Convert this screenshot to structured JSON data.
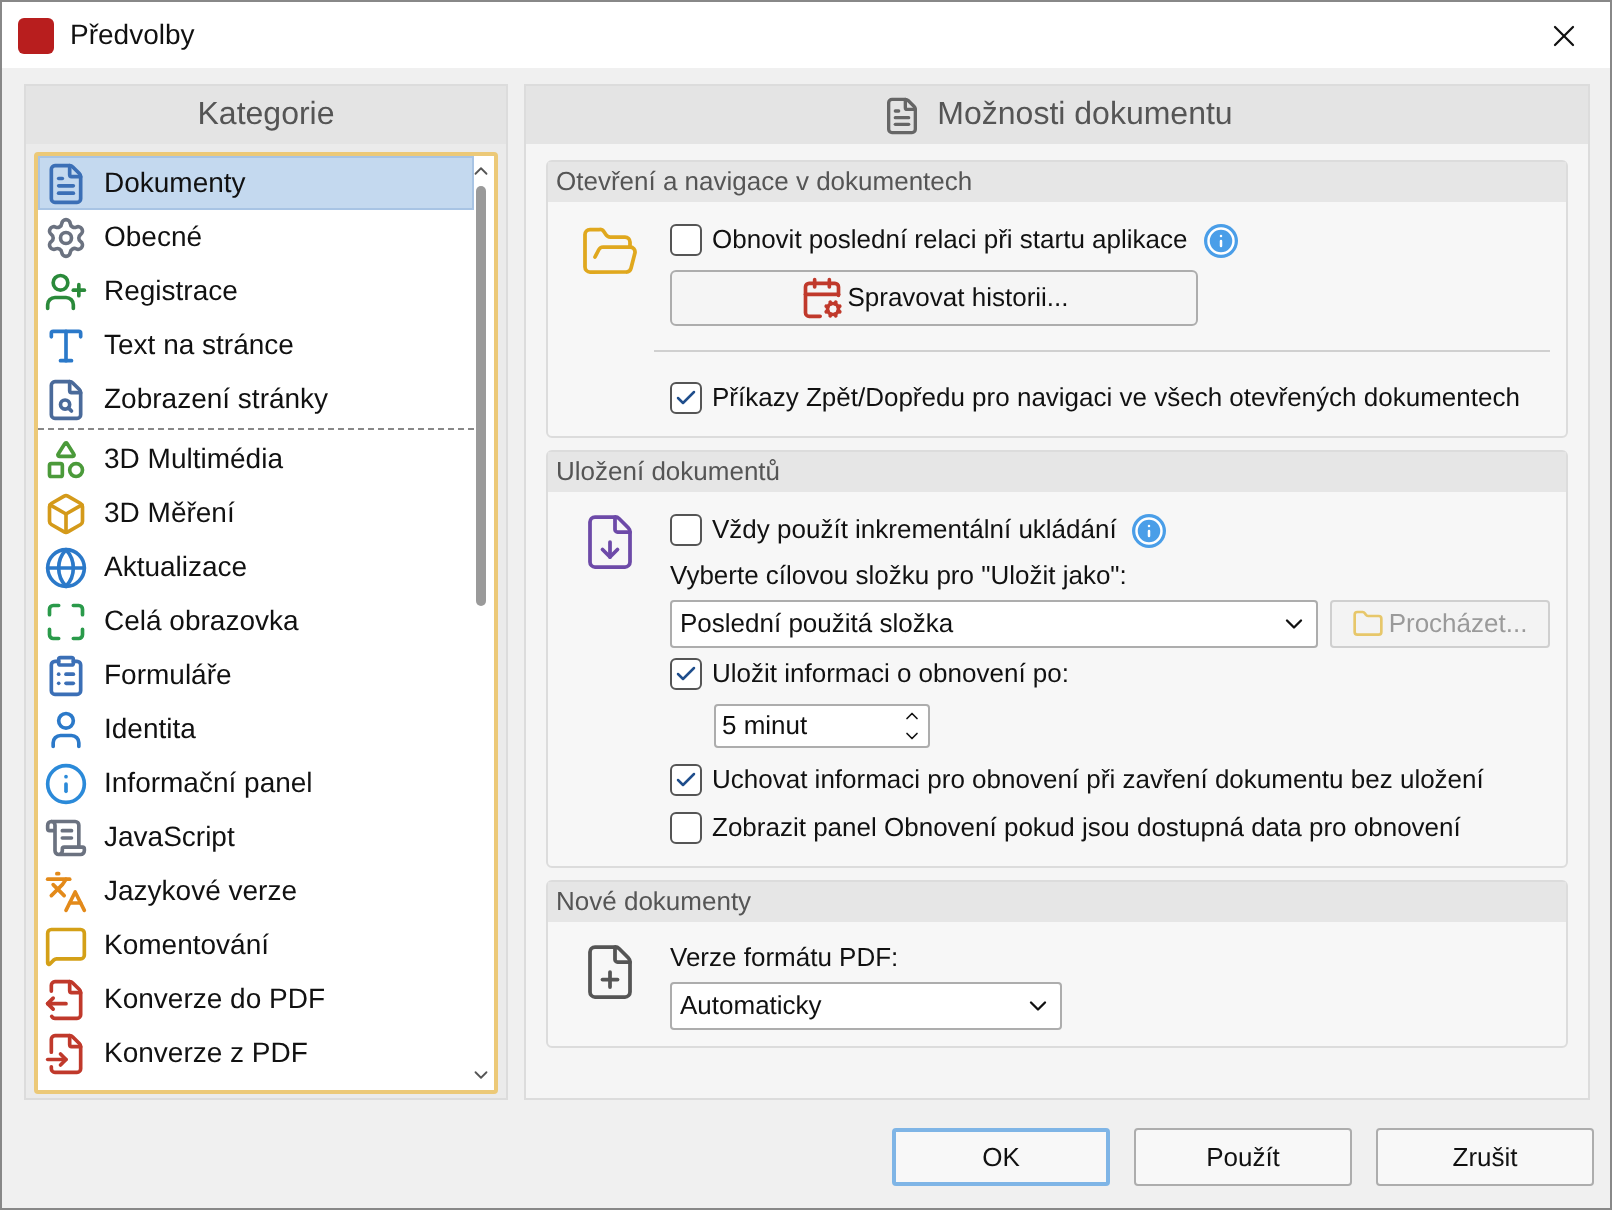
{
  "window": {
    "title": "Předvolby"
  },
  "sidebar": {
    "title": "Kategorie",
    "groups": [
      {
        "items": [
          {
            "label": "Dokumenty",
            "selected": true
          },
          {
            "label": "Obecné",
            "selected": false
          },
          {
            "label": "Registrace",
            "selected": false
          },
          {
            "label": "Text na stránce",
            "selected": false
          },
          {
            "label": "Zobrazení stránky",
            "selected": false
          }
        ]
      },
      {
        "items": [
          {
            "label": "3D Multimédia",
            "selected": false
          },
          {
            "label": "3D Měření",
            "selected": false
          },
          {
            "label": "Aktualizace",
            "selected": false
          },
          {
            "label": "Celá obrazovka",
            "selected": false
          },
          {
            "label": "Formuláře",
            "selected": false
          },
          {
            "label": "Identita",
            "selected": false
          },
          {
            "label": "Informační panel",
            "selected": false
          },
          {
            "label": "JavaScript",
            "selected": false
          },
          {
            "label": "Jazykové verze",
            "selected": false
          },
          {
            "label": "Komentování",
            "selected": false
          },
          {
            "label": "Konverze do PDF",
            "selected": false
          },
          {
            "label": "Konverze z PDF",
            "selected": false
          }
        ]
      }
    ]
  },
  "main": {
    "title": "Možnosti dokumentu",
    "sections": [
      {
        "title": "Otevření a navigace v dokumentech",
        "rows": [
          {
            "kind": "checkbox",
            "label": "Obnovit poslední relaci při startu aplikace",
            "checked": false,
            "info": true
          },
          {
            "kind": "button",
            "label": "Spravovat historii..."
          },
          {
            "kind": "separator"
          },
          {
            "kind": "checkbox",
            "label": "Příkazy Zpět/Dopředu pro navigaci ve všech otevřených dokumentech",
            "checked": true,
            "info": false
          }
        ]
      },
      {
        "title": "Uložení dokumentů",
        "rows": [
          {
            "kind": "checkbox",
            "label": "Vždy použít inkrementální ukládání",
            "checked": false,
            "info": true
          },
          {
            "kind": "label",
            "label": "Vyberte cílovou složku pro \"Uložit jako\":"
          },
          {
            "kind": "select",
            "value": "Poslední použitá složka",
            "browse": {
              "label": "Procházet...",
              "disabled": true
            }
          },
          {
            "kind": "checkbox",
            "label": "Uložit informaci o obnovení po:",
            "checked": true,
            "info": false
          },
          {
            "kind": "spinner",
            "value": "5 minut"
          },
          {
            "kind": "checkbox",
            "label": "Uchovat informaci pro obnovení při zavření dokumentu bez uložení",
            "checked": true,
            "info": false
          },
          {
            "kind": "checkbox",
            "label": "Zobrazit panel Obnovení pokud jsou dostupná data pro obnovení",
            "checked": false,
            "info": false
          }
        ]
      },
      {
        "title": "Nové dokumenty",
        "rows": [
          {
            "kind": "label",
            "label": "Verze formátu PDF:"
          },
          {
            "kind": "select",
            "value": "Automaticky"
          }
        ]
      }
    ]
  },
  "buttons": [
    {
      "label": "OK",
      "default": true
    },
    {
      "label": "Použít",
      "default": false
    },
    {
      "label": "Zrušit",
      "default": false
    }
  ]
}
